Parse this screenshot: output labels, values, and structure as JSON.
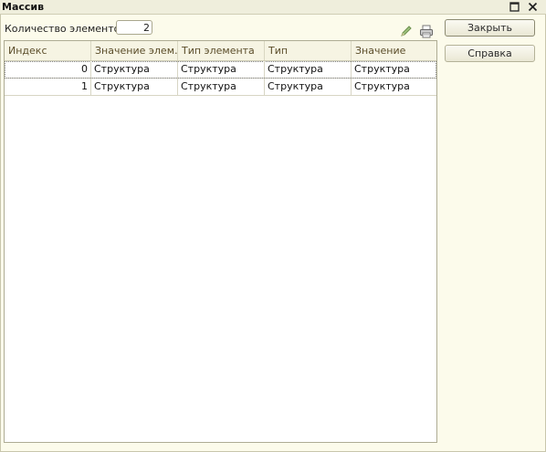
{
  "window": {
    "title": "Массив",
    "maximize_icon": "maximize-icon",
    "close_icon": "close-icon"
  },
  "form": {
    "count_label": "Количество элементов:",
    "count_value": "2",
    "edit_icon": "pencil-icon",
    "print_icon": "printer-icon"
  },
  "table": {
    "columns": [
      "Индекс",
      "Значение элем…",
      "Тип элемента",
      "Тип",
      "Значение"
    ],
    "rows": [
      [
        "0",
        "Структура",
        "Структура",
        "Структура",
        "Структура"
      ],
      [
        "1",
        "Структура",
        "Структура",
        "Структура",
        "Структура"
      ]
    ]
  },
  "buttons": {
    "close_label": "Закрыть",
    "help_label": "Справка"
  },
  "colors": {
    "background": "#fbfaed",
    "header_text": "#5b4d2a",
    "pencil": "#7aa35a"
  }
}
